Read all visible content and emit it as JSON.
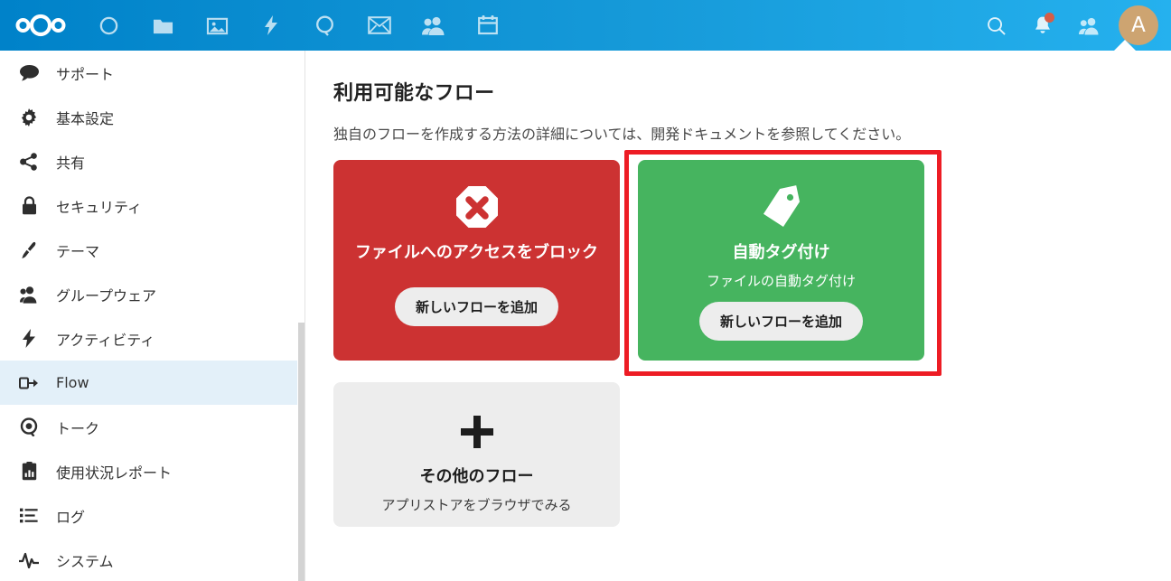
{
  "colors": {
    "header_blue_left": "#0082c9",
    "header_blue_right": "#25b1ee",
    "active_sidebar": "#e3f0f9",
    "card_red": "#cc3232",
    "card_green": "#46b45f",
    "card_gray": "#ededed",
    "annotation_red": "#ed1c24",
    "avatar": "#cda471",
    "notification_dot": "#f4512c"
  },
  "header": {
    "logo": "nextcloud-logo",
    "nav_icons": [
      {
        "name": "circles-icon"
      },
      {
        "name": "files-icon"
      },
      {
        "name": "photos-icon"
      },
      {
        "name": "activity-icon"
      },
      {
        "name": "search-circle-icon"
      },
      {
        "name": "mail-icon"
      },
      {
        "name": "contacts-icon"
      },
      {
        "name": "calendar-icon"
      }
    ],
    "right_icons": [
      {
        "name": "search-icon"
      },
      {
        "name": "notifications-bell-icon",
        "has_badge": true
      },
      {
        "name": "contacts-menu-icon"
      }
    ],
    "avatar_initial": "A"
  },
  "sidebar": {
    "items": [
      {
        "label": "サポート",
        "icon": "comment-icon",
        "active": false
      },
      {
        "label": "基本設定",
        "icon": "gear-icon",
        "active": false
      },
      {
        "label": "共有",
        "icon": "share-icon",
        "active": false
      },
      {
        "label": "セキュリティ",
        "icon": "lock-icon",
        "active": false
      },
      {
        "label": "テーマ",
        "icon": "brush-icon",
        "active": false
      },
      {
        "label": "グループウェア",
        "icon": "user-icon",
        "active": false
      },
      {
        "label": "アクティビティ",
        "icon": "bolt-icon",
        "active": false
      },
      {
        "label": "Flow",
        "icon": "flow-icon",
        "active": true
      },
      {
        "label": "トーク",
        "icon": "talk-icon",
        "active": false
      },
      {
        "label": "使用状況レポート",
        "icon": "report-icon",
        "active": false
      },
      {
        "label": "ログ",
        "icon": "list-icon",
        "active": false
      },
      {
        "label": "システム",
        "icon": "pulse-icon",
        "active": false
      }
    ]
  },
  "main": {
    "title": "利用可能なフロー",
    "description": "独自のフローを作成する方法の詳細については、開発ドキュメントを参照してください。",
    "cards": [
      {
        "id": "block-access",
        "icon": "block-octagon-x-icon",
        "title": "ファイルへのアクセスをブロック",
        "subtitle": "",
        "button_label": "新しいフローを追加",
        "color": "#cc3232"
      },
      {
        "id": "auto-tagging",
        "icon": "tag-icon",
        "title": "自動タグ付け",
        "subtitle": "ファイルの自動タグ付け",
        "button_label": "新しいフローを追加",
        "color": "#46b45f"
      },
      {
        "id": "more-flows",
        "icon": "plus-icon",
        "title": "その他のフロー",
        "subtitle": "アプリストアをブラウザでみる",
        "button_label": "",
        "color": "#ededed"
      }
    ]
  },
  "annotation": {
    "name": "highlight-rectangle",
    "target": "auto-tagging-card",
    "color": "#ed1c24"
  }
}
